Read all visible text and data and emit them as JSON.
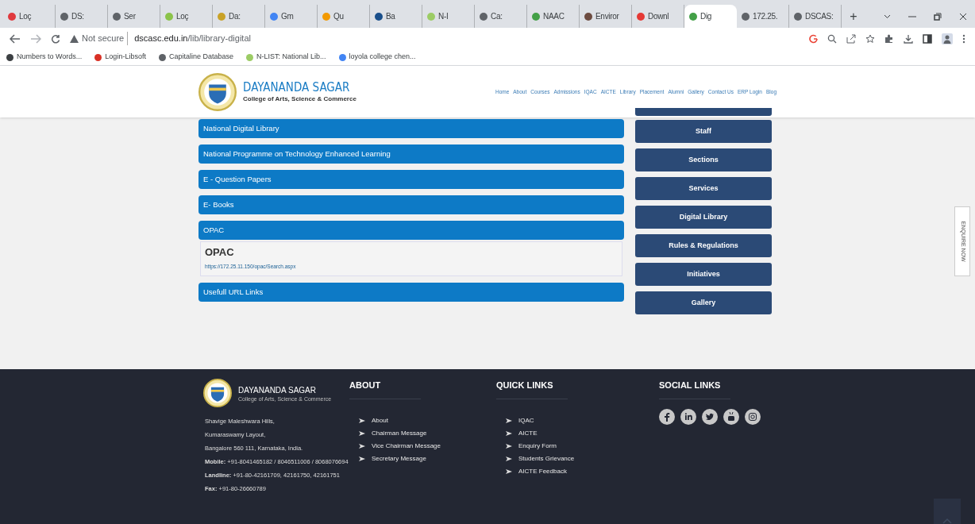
{
  "browser": {
    "tabs": [
      {
        "label": "Loç",
        "selected": false,
        "color": "#e0393e"
      },
      {
        "label": "DS:",
        "selected": false,
        "color": "#5f6368"
      },
      {
        "label": "Ser",
        "selected": false,
        "color": "#5f6368"
      },
      {
        "label": "Loç",
        "selected": false,
        "color": "#8bc34a"
      },
      {
        "label": "Da:",
        "selected": false,
        "color": "#c9a227"
      },
      {
        "label": "Gm",
        "selected": false,
        "color": "#4285f4"
      },
      {
        "label": "Qu",
        "selected": false,
        "color": "#f29900"
      },
      {
        "label": "Ba",
        "selected": false,
        "color": "#1a4f8b"
      },
      {
        "label": "N-I",
        "selected": false,
        "color": "#9ccc65"
      },
      {
        "label": "Ca:",
        "selected": false,
        "color": "#5f6368"
      },
      {
        "label": "NAAC",
        "selected": false,
        "color": "#43a047"
      },
      {
        "label": "Enviror",
        "selected": false,
        "color": "#6d4c41"
      },
      {
        "label": "Downl",
        "selected": false,
        "color": "#e53935"
      },
      {
        "label": "Dig",
        "selected": true,
        "color": "#43a047"
      },
      {
        "label": "172.25.",
        "selected": false,
        "color": "#5f6368"
      },
      {
        "label": "DSCAS:",
        "selected": false,
        "color": "#5f6368"
      }
    ],
    "new_tab": "+",
    "address": {
      "security": "Not secure",
      "url_host": "dscasc.edu.in",
      "url_path": "/lib/library-digital"
    },
    "bookmarks": [
      {
        "label": "Numbers to Words..."
      },
      {
        "label": "Login-Libsoft"
      },
      {
        "label": "Capitaline Database"
      },
      {
        "label": "N-LIST: National Lib..."
      },
      {
        "label": "loyola college chen..."
      }
    ]
  },
  "header": {
    "name": "DAYANANDA SAGAR",
    "subtitle": "College of Arts, Science & Commerce",
    "nav": [
      "Home",
      "About",
      "Courses",
      "Admissions",
      "IQAC",
      "AICTE",
      "Library",
      "Placement",
      "Alumni",
      "Gallery",
      "Contact Us",
      "ERP Login",
      "Blog"
    ]
  },
  "accordion": [
    {
      "title": "National Digital Library"
    },
    {
      "title": "National Programme on Technology Enhanced Learning"
    },
    {
      "title": "E - Question Papers"
    },
    {
      "title": "E- Books"
    },
    {
      "title": "OPAC",
      "panel": {
        "heading": "OPAC",
        "link": "https://172.25.11.150/opac/Search.aspx"
      }
    },
    {
      "title": "Usefull URL Links"
    }
  ],
  "side_menu": [
    "Staff",
    "Sections",
    "Services",
    "Digital Library",
    "Rules & Regulations",
    "Initiatives",
    "Gallery"
  ],
  "enquire": "ENQUIRE NOW",
  "footer": {
    "name": "DAYANANDA SAGAR",
    "subtitle": "College of Arts, Science & Commerce",
    "address": [
      {
        "text": "Shavige Maleshwara Hills,"
      },
      {
        "text": "Kumaraswamy Layout,"
      },
      {
        "text": "Bangalore 560 111, Karnataka, India."
      },
      {
        "text": "**Mobile:** +91-8041465182 / 8046511006 / 8068076694"
      },
      {
        "text": "**Landline:** +91-80-42161709, 42161750, 42161751"
      },
      {
        "text": "**Fax:** +91-80-26660789"
      }
    ],
    "columns": [
      {
        "title": "ABOUT",
        "links": [
          "About",
          "Chairman Message",
          "Vice Chairman Message",
          "Secretary Message"
        ]
      },
      {
        "title": "QUICK LINKS",
        "links": [
          "IQAC",
          "AICTE",
          "Enquiry Form",
          "Students Grievance",
          "AICTE Feedback"
        ]
      }
    ],
    "social_title": "SOCIAL LINKS"
  }
}
